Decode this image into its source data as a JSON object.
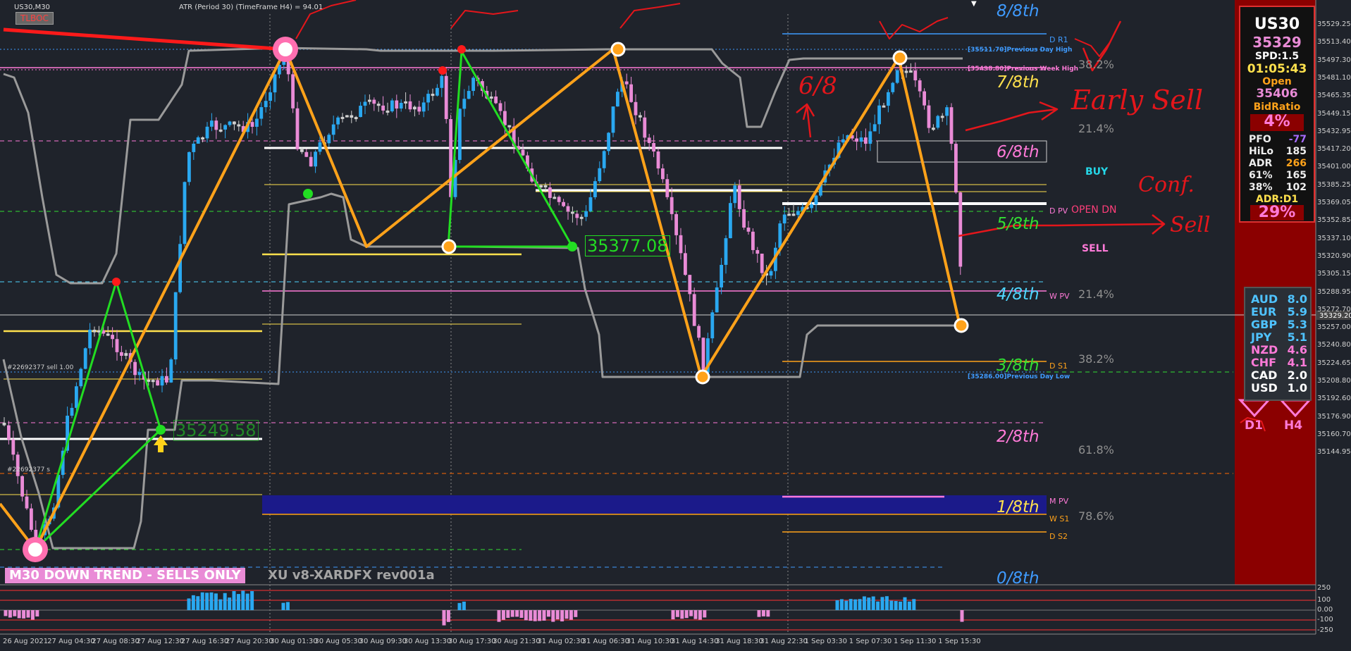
{
  "header": {
    "symbol_tf": "US30,M30",
    "tlboc_button": "TLBOC",
    "atr_text": "ATR (Period 30) (TimeFrame H4) = 94.01"
  },
  "banner": {
    "trend": "M30  DOWN TREND - SELLS ONLY",
    "version": "XU v8-XARDFX rev001a"
  },
  "murrey": {
    "m8": "8/8th",
    "m7": "7/8th",
    "m6": "6/8th",
    "m5": "5/8th",
    "m4": "4/8th",
    "m3": "3/8th",
    "m2": "2/8th",
    "m1": "1/8th",
    "m0": "0/8th"
  },
  "fib": {
    "f1": "38.2%",
    "f2": "21.4%",
    "f3": "21.4%",
    "f4": "38.2%",
    "f5": "61.8%",
    "f6": "78.6%"
  },
  "levels": {
    "dr1": "D R1",
    "dpv": "D PV",
    "wpv": "W PV",
    "ds1": "D S1",
    "mpv": "M PV",
    "ws1": "W S1",
    "ds2": "D S2",
    "pdh": "[35511.70]Previous Day High",
    "pwh": "[35498.80]Previous Week High",
    "pdl": "[35286.00]Previous Day Low",
    "open_dn": "OPEN  DN",
    "buy": "BUY",
    "sell": "SELL"
  },
  "orders": {
    "o1": "#22692377 sell 1.00",
    "o2": "#22692377 s"
  },
  "price_labels": {
    "zz1": "35377.08",
    "zz2": "35249.58",
    "current": "35329.20"
  },
  "annotations": {
    "early_sell": "Early Sell",
    "six_eight": "6/8",
    "conf": "Conf.",
    "sell": "Sell"
  },
  "panel": {
    "symbol": "US30",
    "price": "35329",
    "spread": "SPD:1.5",
    "timer": "01:05:43",
    "open_label": "Open",
    "open_value": "35406",
    "bidratio_label": "BidRatio",
    "bidratio_value": "4%",
    "rows": [
      {
        "k": "PFO",
        "v": "-77"
      },
      {
        "k": "HiLo",
        "v": "185"
      },
      {
        "k": "ADR",
        "v": "266"
      },
      {
        "k": "61%",
        "v": "165"
      },
      {
        "k": "38%",
        "v": "102"
      }
    ],
    "adr_label": "ADR:D1",
    "adr_value": "29%"
  },
  "currency_strength": [
    {
      "k": "AUD",
      "v": "8.0",
      "color": "#4fc3ff"
    },
    {
      "k": "EUR",
      "v": "5.9",
      "color": "#4fc3ff"
    },
    {
      "k": "GBP",
      "v": "5.3",
      "color": "#4fc3ff"
    },
    {
      "k": "JPY",
      "v": "5.1",
      "color": "#4fc3ff"
    },
    {
      "k": "NZD",
      "v": "4.6",
      "color": "#ff7ad8"
    },
    {
      "k": "CHF",
      "v": "4.1",
      "color": "#ff7ad8"
    },
    {
      "k": "CAD",
      "v": "2.0",
      "color": "#ffffff"
    },
    {
      "k": "USD",
      "v": "1.0",
      "color": "#ffffff"
    }
  ],
  "timeframes": {
    "d1": "D1",
    "h4": "H4"
  },
  "price_axis": [
    "35529.25",
    "35513.40",
    "35497.30",
    "35481.10",
    "35465.35",
    "35449.15",
    "35432.95",
    "35417.20",
    "35401.00",
    "35385.25",
    "35369.05",
    "35352.85",
    "35337.10",
    "35320.90",
    "35305.15",
    "35288.95",
    "35272.70",
    "35257.00",
    "35240.80",
    "35224.65",
    "35208.80",
    "35192.60",
    "35176.90",
    "35160.70",
    "35144.95"
  ],
  "osc_axis": [
    "250",
    "100",
    "0.00",
    "-100",
    "-250"
  ],
  "time_axis": [
    "26 Aug 2021",
    "27 Aug 04:30",
    "27 Aug 08:30",
    "27 Aug 12:30",
    "27 Aug 16:30",
    "27 Aug 20:30",
    "30 Aug 01:30",
    "30 Aug 05:30",
    "30 Aug 09:30",
    "30 Aug 13:30",
    "30 Aug 17:30",
    "30 Aug 21:30",
    "31 Aug 02:30",
    "31 Aug 06:30",
    "31 Aug 10:30",
    "31 Aug 14:30",
    "31 Aug 18:30",
    "31 Aug 22:30",
    "1 Sep 03:30",
    "1 Sep 07:30",
    "1 Sep 11:30",
    "1 Sep 15:30"
  ],
  "colors": {
    "background": "#1f232b",
    "bull": "#2aa8f0",
    "bear": "#e98bd6",
    "neutral": "#d0d0d0",
    "zigzag_orange": "#ffa21a",
    "zigzag_green": "#22dd22",
    "panel_red": "#8b0000"
  }
}
